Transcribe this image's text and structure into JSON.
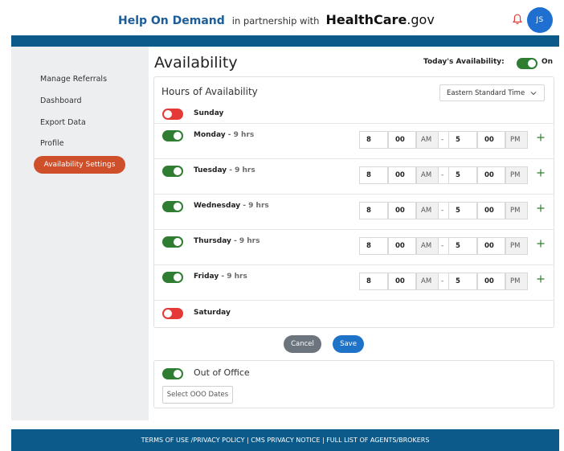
{
  "header": {
    "brand_main": "Help On Demand",
    "brand_partner": "in partnership with",
    "brand_hc": "HealthCare",
    "brand_gov": ".gov",
    "avatar_initials": "JS",
    "bell_icon": "bell-icon",
    "bell_color": "#e53935"
  },
  "sidebar": {
    "items": [
      {
        "label": "Manage Referrals"
      },
      {
        "label": "Dashboard"
      },
      {
        "label": "Export Data"
      },
      {
        "label": "Profile"
      },
      {
        "label": "Availability Settings",
        "active": true
      }
    ]
  },
  "main": {
    "title": "Availability",
    "today_label": "Today's Availability:",
    "today_state": "On",
    "hours_title": "Hours of Availability",
    "timezone": "Eastern Standard Time",
    "days": [
      {
        "name": "Sunday",
        "enabled": false,
        "hrs": ""
      },
      {
        "name": "Monday",
        "enabled": true,
        "hrs": " - 9 hrs",
        "start_h": "8",
        "start_m": "00",
        "start_ampm": "AM",
        "end_h": "5",
        "end_m": "00",
        "end_ampm": "PM"
      },
      {
        "name": "Tuesday",
        "enabled": true,
        "hrs": " - 9 hrs",
        "start_h": "8",
        "start_m": "00",
        "start_ampm": "AM",
        "end_h": "5",
        "end_m": "00",
        "end_ampm": "PM"
      },
      {
        "name": "Wednesday",
        "enabled": true,
        "hrs": " - 9 hrs",
        "start_h": "8",
        "start_m": "00",
        "start_ampm": "AM",
        "end_h": "5",
        "end_m": "00",
        "end_ampm": "PM"
      },
      {
        "name": "Thursday",
        "enabled": true,
        "hrs": " - 9 hrs",
        "start_h": "8",
        "start_m": "00",
        "start_ampm": "AM",
        "end_h": "5",
        "end_m": "00",
        "end_ampm": "PM"
      },
      {
        "name": "Friday",
        "enabled": true,
        "hrs": " - 9 hrs",
        "start_h": "8",
        "start_m": "00",
        "start_ampm": "AM",
        "end_h": "5",
        "end_m": "00",
        "end_ampm": "PM"
      },
      {
        "name": "Saturday",
        "enabled": false,
        "hrs": ""
      }
    ],
    "time_separator": "-",
    "cancel_label": "Cancel",
    "save_label": "Save",
    "ooo_title": "Out of Office",
    "ooo_enabled": true,
    "ooo_input_placeholder": "Select OOO Dates"
  },
  "footer": {
    "links": [
      "TERMS OF USE /PRIVACY POLICY",
      " | ",
      "CMS PRIVACY NOTICE",
      " | ",
      "FULL LIST OF AGENTS/BROKERS"
    ]
  },
  "colors": {
    "brand_blue": "#1c5d99",
    "bar_blue": "#0b5a8a",
    "active_nav": "#cf4f2b",
    "toggle_on": "#2e7d32",
    "toggle_off": "#e53935",
    "save_blue": "#1e73c9",
    "cancel_gray": "#6c757d",
    "plus_green": "#2e7d32"
  }
}
